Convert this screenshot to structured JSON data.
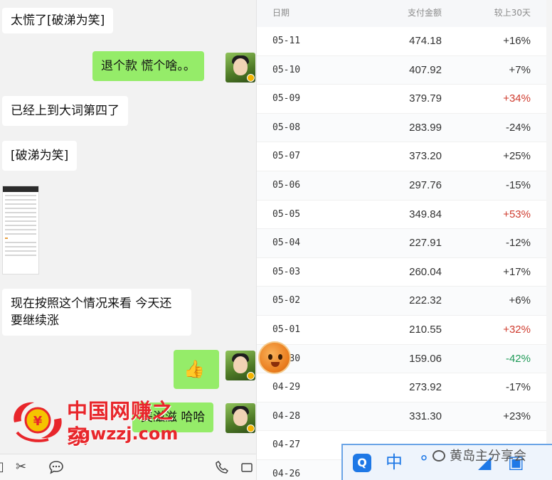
{
  "chat": {
    "messages": [
      {
        "side": "in",
        "text": "太慌了[破涕为笑]"
      },
      {
        "side": "out",
        "text": "退个款 慌个啥。。"
      },
      {
        "side": "in",
        "text": "已经上到大词第四了"
      },
      {
        "side": "in",
        "text": "[破涕为笑]"
      },
      {
        "side": "in",
        "text": "现在按照这个情况来看 今天还",
        "text2": "要继续涨"
      },
      {
        "side": "out",
        "text": "👍"
      },
      {
        "side": "out",
        "text": "美滋滋 哈哈"
      }
    ],
    "toolbar_icons": [
      "folder-icon",
      "scissors-icon",
      "chat-bubble-icon",
      "phone-icon",
      "video-icon"
    ]
  },
  "watermark": {
    "title": "中国网赚之家",
    "url": "zgwzzj.com"
  },
  "table": {
    "headers": {
      "date": "日期",
      "amount": "支付金额",
      "change": "较上30天"
    },
    "rows": [
      {
        "date": "05-11",
        "amount": "474.18",
        "change": "+16%",
        "tone": ""
      },
      {
        "date": "05-10",
        "amount": "407.92",
        "change": "+7%",
        "tone": ""
      },
      {
        "date": "05-09",
        "amount": "379.79",
        "change": "+34%",
        "tone": "up-strong"
      },
      {
        "date": "05-08",
        "amount": "283.99",
        "change": "-24%",
        "tone": ""
      },
      {
        "date": "05-07",
        "amount": "373.20",
        "change": "+25%",
        "tone": ""
      },
      {
        "date": "05-06",
        "amount": "297.76",
        "change": "-15%",
        "tone": ""
      },
      {
        "date": "05-05",
        "amount": "349.84",
        "change": "+53%",
        "tone": "up-strong"
      },
      {
        "date": "05-04",
        "amount": "227.91",
        "change": "-12%",
        "tone": ""
      },
      {
        "date": "05-03",
        "amount": "260.04",
        "change": "+17%",
        "tone": ""
      },
      {
        "date": "05-02",
        "amount": "222.32",
        "change": "+6%",
        "tone": ""
      },
      {
        "date": "05-01",
        "amount": "210.55",
        "change": "+32%",
        "tone": "up-strong"
      },
      {
        "date": "04-30",
        "amount": "159.06",
        "change": "-42%",
        "tone": "down-strong"
      },
      {
        "date": "04-29",
        "amount": "273.92",
        "change": "-17%",
        "tone": ""
      },
      {
        "date": "04-28",
        "amount": "331.30",
        "change": "+23%",
        "tone": ""
      },
      {
        "date": "04-27",
        "amount": "",
        "change": "",
        "tone": ""
      },
      {
        "date": "04-26",
        "amount": "",
        "change": "",
        "tone": ""
      }
    ]
  },
  "ime": {
    "mode": "中"
  },
  "watermark2": {
    "text": "黄岛主分享会"
  },
  "colors": {
    "up_strong": "#cf3b2e",
    "down_strong": "#1f9a57",
    "bubble_out": "#95ec69",
    "ime_blue": "#1e78e6",
    "watermark_red": "#e8262b"
  }
}
